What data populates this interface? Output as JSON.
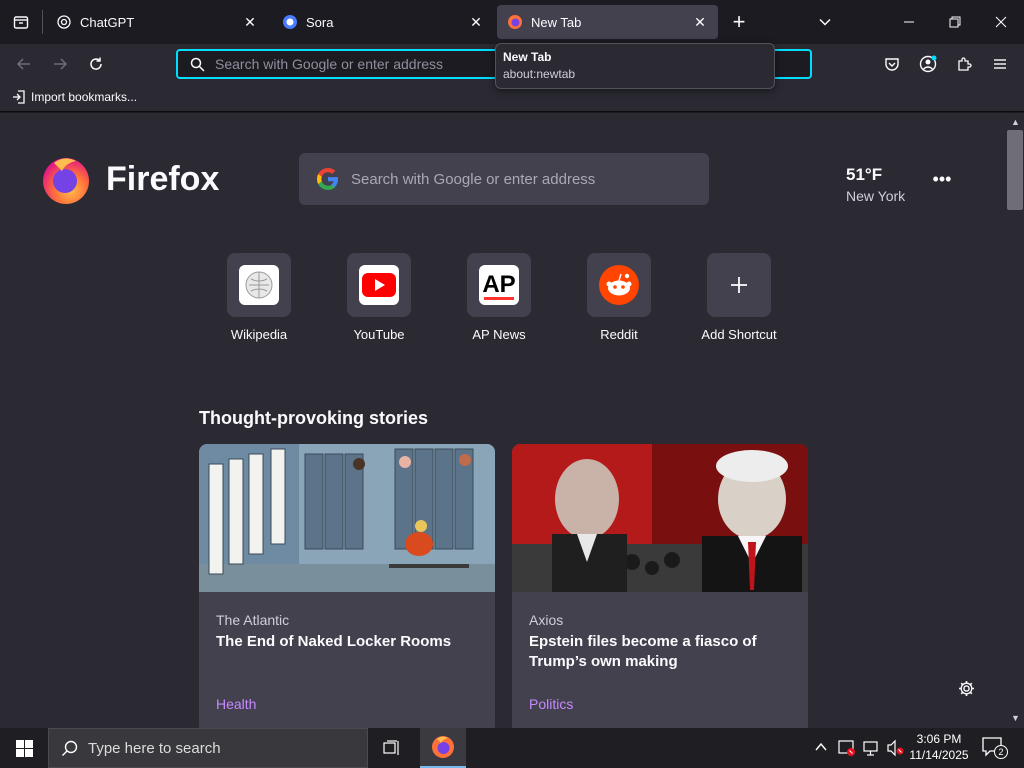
{
  "tabs": [
    {
      "label": "ChatGPT",
      "icon": "chatgpt-icon"
    },
    {
      "label": "Sora",
      "icon": "sora-icon"
    },
    {
      "label": "New Tab",
      "icon": "firefox-icon",
      "selected": true
    }
  ],
  "tooltip": {
    "title": "New Tab",
    "url": "about:newtab"
  },
  "urlbar": {
    "placeholder": "Search with Google or enter address"
  },
  "bookmarks": {
    "import_label": "Import bookmarks..."
  },
  "newtab": {
    "logo_text": "Firefox",
    "search_placeholder": "Search with Google or enter address",
    "weather": {
      "temp": "51°F",
      "location": "New York"
    },
    "shortcuts": [
      {
        "label": "Wikipedia",
        "icon": "wikipedia-icon"
      },
      {
        "label": "YouTube",
        "icon": "youtube-icon"
      },
      {
        "label": "AP News",
        "icon": "apnews-icon"
      },
      {
        "label": "Reddit",
        "icon": "reddit-icon"
      },
      {
        "label": "Add Shortcut",
        "icon": "plus-icon"
      }
    ],
    "stories_heading": "Thought-provoking stories",
    "stories": [
      {
        "source": "The Atlantic",
        "headline": "The End of Naked Locker Rooms",
        "topic": "Health"
      },
      {
        "source": "Axios",
        "headline": "Epstein files become a fiasco of Trump’s own making",
        "topic": "Politics"
      }
    ]
  },
  "taskbar": {
    "search_placeholder": "Type here to search",
    "time": "3:06 PM",
    "date": "11/14/2025",
    "notification_count": "2"
  },
  "colors": {
    "accent": "#00ddff",
    "topic": "#c689ff",
    "bg": "#2b2a33",
    "tile": "#42414d"
  }
}
